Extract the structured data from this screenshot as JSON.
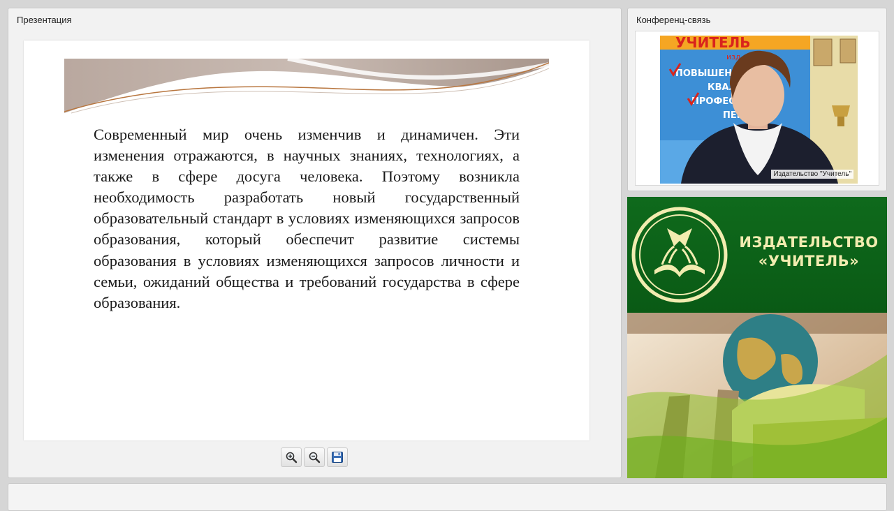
{
  "presentation": {
    "title": "Презентация",
    "slide_text": "Современный мир очень изменчив и динамичен. Эти изменения отражаются, в научных знаниях, технологиях, а также в сфере досуга человека. Поэтому возникла необходимость разработать новый государственный образовательный стандарт в условиях изменяющихся запросов образования, который обеспечит развитие системы образования в условиях изменяющихся запросов личности и семьи, ожиданий общества и требований государства в сфере образования.",
    "toolbar": {
      "zoom_in_icon": "zoom-in-icon",
      "zoom_out_icon": "zoom-out-icon",
      "save_icon": "floppy-disk-icon"
    }
  },
  "conference": {
    "title": "Конференц-связь",
    "participant_caption": "Издательство \"Учитель\"",
    "backdrop_banner_text": [
      "УЧИТЕЛЬ",
      "изд",
      "ПОВЫШЕНИ",
      "КВАЛИ",
      "ПРОФЕСС",
      "ПЕРЕ"
    ]
  },
  "brand": {
    "name_line1": "ИЗДАТЕЛЬСТВО",
    "name_line2": "«УЧИТЕЛЬ»",
    "logo_icon": "book-emblem-icon",
    "colors": {
      "green": "#0f6a1c",
      "gold": "#f2ecb0"
    }
  }
}
